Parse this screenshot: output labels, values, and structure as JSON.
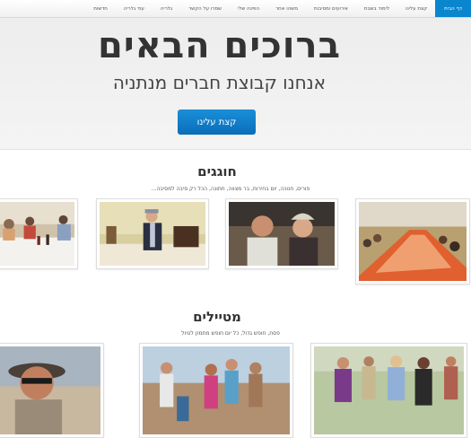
{
  "nav": {
    "items": [
      {
        "label": "דף הבית",
        "active": true
      },
      {
        "label": "קצת עלינו"
      },
      {
        "label": "לימוד בשבת"
      },
      {
        "label": "אירועים ומסיבות"
      },
      {
        "label": "משהו אחר"
      },
      {
        "label": "הפינה שלי"
      },
      {
        "label": "שמרו על הקשר"
      },
      {
        "label": "גלריה"
      },
      {
        "label": "עוד גלריה"
      },
      {
        "label": "חדשות"
      }
    ]
  },
  "hero": {
    "title": "ברוכים הבאים",
    "subtitle": "אנחנו קבוצת חברים מנתניה",
    "button_label": "קצת עלינו"
  },
  "sections": {
    "celebrations": {
      "title": "חוגגים",
      "description": "פורים, חנוכה, יום בחירות, בר מצווה, חתונה, הכל רק סיבה למסיבה..."
    },
    "hikers": {
      "title": "מטיילים",
      "description": "פסח, חופש גדול, כל יום חופש מתמזן לטיול"
    }
  },
  "colors": {
    "brand": "#0a86cf",
    "hero_bg": "#f0f0f0"
  }
}
